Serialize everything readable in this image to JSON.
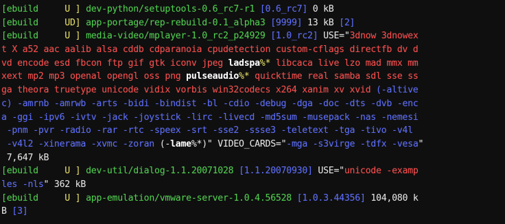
{
  "terminal": {
    "lines": [
      [
        {
          "text": "[",
          "c": "g"
        },
        {
          "text": "ebuild",
          "c": "g"
        },
        {
          "text": "     U ] ",
          "c": "y"
        },
        {
          "text": "dev-python/setuptools-0.6_rc7-r1 ",
          "c": "g"
        },
        {
          "text": "[0.6_rc7]",
          "c": "b"
        },
        {
          "text": " 0 kB",
          "c": "w"
        }
      ],
      [
        {
          "text": "[",
          "c": "g"
        },
        {
          "text": "ebuild",
          "c": "g"
        },
        {
          "text": "     UD] ",
          "c": "y"
        },
        {
          "text": "app-portage/rep-rebuild-0.1_alpha3 ",
          "c": "g"
        },
        {
          "text": "[9999]",
          "c": "b"
        },
        {
          "text": " 13 kB ",
          "c": "w"
        },
        {
          "text": "[2]",
          "c": "b"
        }
      ],
      [
        {
          "text": "[",
          "c": "g"
        },
        {
          "text": "ebuild",
          "c": "g"
        },
        {
          "text": "     U ] ",
          "c": "y"
        },
        {
          "text": "media-video/mplayer-1.0_rc2_p24929 ",
          "c": "g"
        },
        {
          "text": "[1.0_rc2]",
          "c": "b"
        },
        {
          "text": " USE=\"",
          "c": "w"
        },
        {
          "text": "3dnow 3dnowex",
          "c": "r"
        }
      ],
      [
        {
          "text": "t X a52 aac aalib alsa cddb cdparanoia cpudetection custom-cflags directfb dv d",
          "c": "r"
        }
      ],
      [
        {
          "text": "vd encode esd fbcon ftp gif gtk iconv jpeg ",
          "c": "r"
        },
        {
          "text": "ladspa",
          "c": "bw"
        },
        {
          "text": "%*",
          "c": "y"
        },
        {
          "text": " libcaca live lzo mad mmx mm",
          "c": "r"
        }
      ],
      [
        {
          "text": "xext mp2 mp3 openal opengl oss png ",
          "c": "r"
        },
        {
          "text": "pulseaudio",
          "c": "bw"
        },
        {
          "text": "%*",
          "c": "y"
        },
        {
          "text": " quicktime real samba sdl sse ss",
          "c": "r"
        }
      ],
      [
        {
          "text": "ga theora truetype unicode vidix vorbis win32codecs x264 xanim xv xvid ",
          "c": "r"
        },
        {
          "text": "(-altive",
          "c": "b"
        }
      ],
      [
        {
          "text": "c) -amrnb -amrwb -arts -bidi -bindist -bl -cdio -debug -dga -doc -dts -dvb -enc",
          "c": "b"
        }
      ],
      [
        {
          "text": "a -ggi -ipv6 -ivtv -jack -joystick -lirc -livecd -md5sum -musepack -nas -nemesi",
          "c": "b"
        }
      ],
      [
        {
          "text": " -pnm -pvr -radio -rar -rtc -speex -srt -sse2 -ssse3 -teletext -tga -tivo -v4l",
          "c": "b"
        }
      ],
      [
        {
          "text": " -v4l2 -xinerama -xvmc -zoran ",
          "c": "b"
        },
        {
          "text": "(-",
          "c": "w"
        },
        {
          "text": "lame",
          "c": "bw"
        },
        {
          "text": "%*)",
          "c": "w"
        },
        {
          "text": "\" VIDEO_CARDS=\"",
          "c": "w"
        },
        {
          "text": "-mga -s3virge -tdfx -vesa",
          "c": "b"
        },
        {
          "text": "\"",
          "c": "w"
        }
      ],
      [
        {
          "text": " 7,647 kB",
          "c": "w"
        }
      ],
      [
        {
          "text": "[",
          "c": "g"
        },
        {
          "text": "ebuild",
          "c": "g"
        },
        {
          "text": "     U ] ",
          "c": "y"
        },
        {
          "text": "dev-util/dialog-1.1.20071028 ",
          "c": "g"
        },
        {
          "text": "[1.1.20070930]",
          "c": "b"
        },
        {
          "text": " USE=\"",
          "c": "w"
        },
        {
          "text": "unicode -examp",
          "c": "r"
        }
      ],
      [
        {
          "text": "les -nls",
          "c": "b"
        },
        {
          "text": "\" 362 kB",
          "c": "w"
        }
      ],
      [
        {
          "text": "[",
          "c": "g"
        },
        {
          "text": "ebuild",
          "c": "g"
        },
        {
          "text": "     U ] ",
          "c": "y"
        },
        {
          "text": "app-emulation/vmware-server-1.0.4.56528 ",
          "c": "g"
        },
        {
          "text": "[1.0.3.44356]",
          "c": "b"
        },
        {
          "text": " 104,080 k",
          "c": "w"
        }
      ],
      [
        {
          "text": "B ",
          "c": "w"
        },
        {
          "text": "[3]",
          "c": "b"
        }
      ]
    ]
  }
}
